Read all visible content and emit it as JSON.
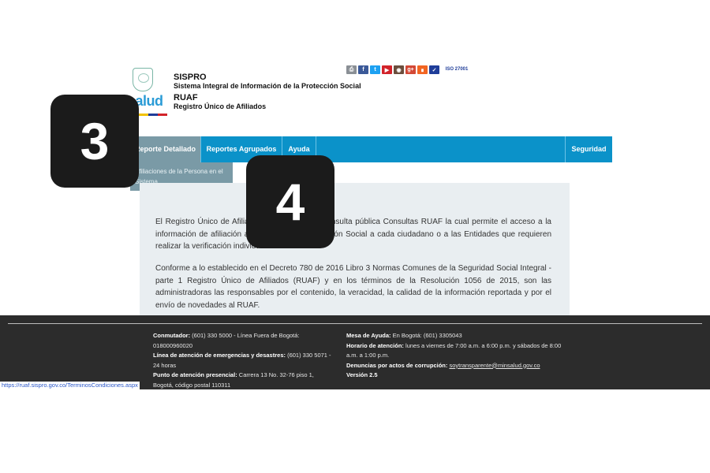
{
  "header": {
    "logo_text": "salud",
    "sispro_title": "SISPRO",
    "sispro_subtitle": "Sistema Integral de Información de la Protección Social",
    "ruaf_title": "RUAF",
    "ruaf_subtitle": "Registro Único de Afiliados"
  },
  "nav": {
    "items": [
      {
        "label": "Reporte Detallado",
        "active": true
      },
      {
        "label": "Reportes Agrupados",
        "active": false
      },
      {
        "label": "Ayuda",
        "active": false
      }
    ],
    "right_label": "Seguridad",
    "submenu_item": "Afiliaciones de la Persona en el Sistema"
  },
  "content": {
    "paragraph1": "El Registro Único de Afiliados dispone para la consulta pública Consultas RUAF la cual permite el acceso a la información de afiliación al Sistema de la Protección Social a cada ciudadano o a las Entidades que requieren realizar la verificación individual.",
    "paragraph2": "Conforme a lo establecido en el Decreto 780 de 2016 Libro 3 Normas Comunes de la Seguridad Social Integral - parte 1 Registro Único de Afiliados (RUAF) y en los términos de la Resolución 1056 de 2015, son las administradoras las responsables por el contenido, la veracidad, la calidad de la información reportada y por el envío de novedades al RUAF."
  },
  "footer": {
    "left": {
      "conmutador_label": "Conmutador:",
      "conmutador_value": "(601) 330 5000 - Línea Fuera de Bogotá: 018000960020",
      "emergencias_label": "Línea de atención de emergencias y desastres:",
      "emergencias_value": "(601) 330 5071 - 24 horas",
      "presencial_label": "Punto de atención presencial:",
      "presencial_value": "Carrera 13 No. 32-76 piso 1, Bogotá, código postal 110311"
    },
    "right": {
      "mesa_label": "Mesa de Ayuda:",
      "mesa_value": "En Bogotá: (601) 3305043",
      "horario_label": "Horario de atención:",
      "horario_value": "lunes a viernes de 7:00 a.m. a 6:00 p.m. y sábados de 8:00 a.m. a 1:00 p.m.",
      "denuncias_label": "Denuncias por actos de corrupción:",
      "denuncias_email": "soytransparente@minsalud.gov.co",
      "version": "Versión 2.5"
    },
    "social_icons": [
      "print-icon",
      "facebook-icon",
      "twitter-icon",
      "youtube-icon",
      "instagram-icon",
      "google-plus-icon",
      "rss-icon",
      "checkbox-icon"
    ],
    "iso_label": "ISO 27001"
  },
  "status_bar_url": "https://ruaf.sispro.gov.co/TerminosCondiciones.aspx",
  "overlay": {
    "badge_3": "3",
    "badge_4": "4"
  },
  "colors": {
    "nav_blue": "#0b92c9",
    "nav_active": "#7a9aa6",
    "footer_bg": "#2c2c2c",
    "panel_bg": "#e9eef1"
  }
}
